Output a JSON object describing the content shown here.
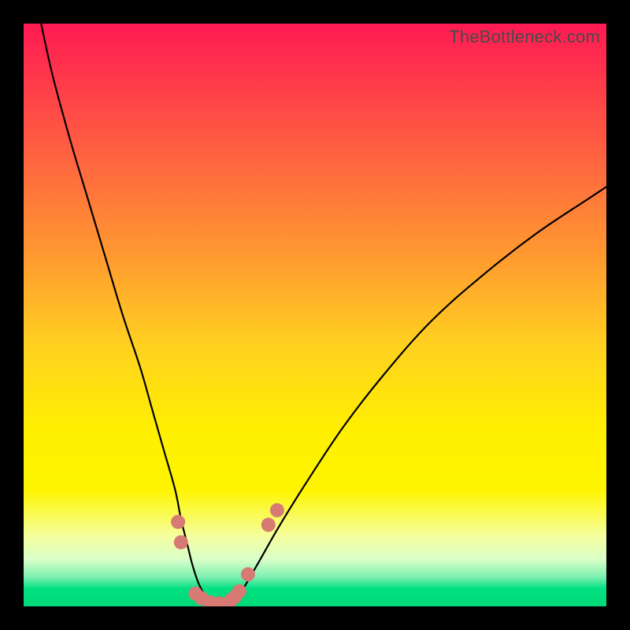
{
  "watermark": "TheBottleneck.com",
  "colors": {
    "frame": "#000000",
    "gradient_top": "#ff1a53",
    "gradient_bottom": "#00d878",
    "curve": "#000000",
    "dots": "#d87a74"
  },
  "chart_data": {
    "type": "line",
    "title": "",
    "xlabel": "",
    "ylabel": "",
    "xlim": [
      0,
      100
    ],
    "ylim": [
      0,
      100
    ],
    "grid": false,
    "legend": false,
    "note": "Background heatmap gradient (red=high, green=low) with overlaid V-shaped bottleneck curve. No axis tick labels present.",
    "series": [
      {
        "name": "left-branch",
        "x": [
          3,
          5,
          8,
          11,
          14,
          17,
          20,
          22,
          24,
          26,
          27,
          28,
          29,
          30,
          31,
          32
        ],
        "y": [
          100,
          91,
          80,
          70,
          60,
          50,
          41,
          34,
          27,
          20,
          15,
          11,
          7,
          4,
          2,
          0
        ]
      },
      {
        "name": "right-branch",
        "x": [
          35,
          37,
          40,
          44,
          49,
          55,
          62,
          70,
          79,
          88,
          97,
          100
        ],
        "y": [
          0,
          2,
          7,
          14,
          22,
          31,
          40,
          49,
          57,
          64,
          70,
          72
        ]
      }
    ],
    "markers": [
      {
        "x": 26.5,
        "y": 14.5
      },
      {
        "x": 27.0,
        "y": 11.0
      },
      {
        "x": 29.5,
        "y": 2.2
      },
      {
        "x": 30.5,
        "y": 1.4
      },
      {
        "x": 32.0,
        "y": 0.7
      },
      {
        "x": 33.5,
        "y": 0.5
      },
      {
        "x": 35.5,
        "y": 1.0
      },
      {
        "x": 36.2,
        "y": 1.6
      },
      {
        "x": 37.0,
        "y": 2.6
      },
      {
        "x": 38.5,
        "y": 5.5
      },
      {
        "x": 42.0,
        "y": 14.0
      },
      {
        "x": 43.5,
        "y": 16.5
      }
    ]
  }
}
